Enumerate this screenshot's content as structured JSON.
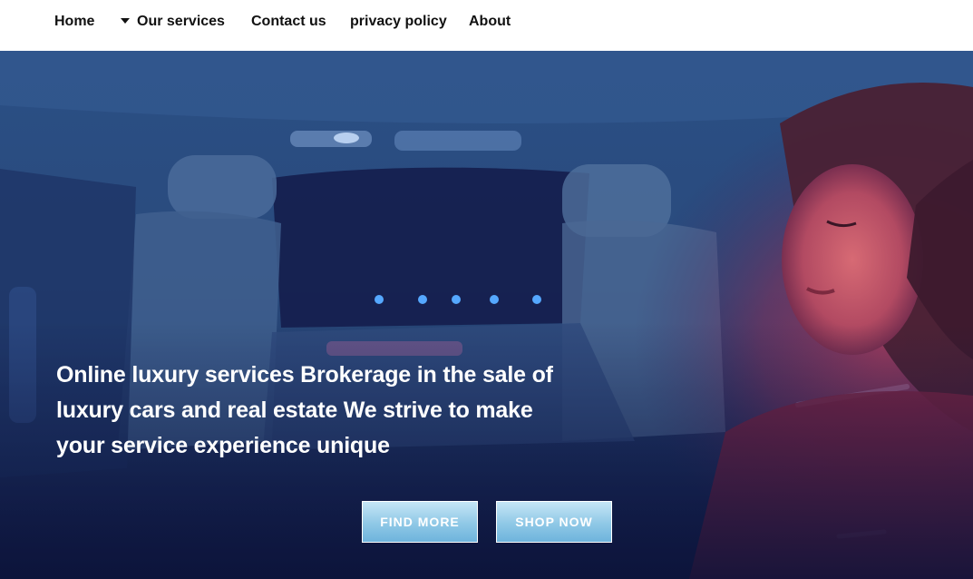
{
  "nav": {
    "items": [
      {
        "label": "Home"
      },
      {
        "label": "Our services",
        "has_dropdown": true
      },
      {
        "label": "Contact us"
      },
      {
        "label": "privacy policy"
      },
      {
        "label": "About"
      }
    ]
  },
  "hero": {
    "headline": "Online luxury services Brokerage in the sale of luxury cars and real estate We strive to make your service experience unique",
    "buttons": {
      "find_more": "FIND MORE",
      "shop_now": "SHOP NOW"
    }
  },
  "colors": {
    "nav_background": "#ffffff",
    "nav_text": "#111111",
    "hero_overlay": "#1e2f5c",
    "button_fill": "#8fc8e6",
    "button_text": "#ffffff"
  },
  "icons": {
    "dropdown": "caret-down-icon"
  }
}
